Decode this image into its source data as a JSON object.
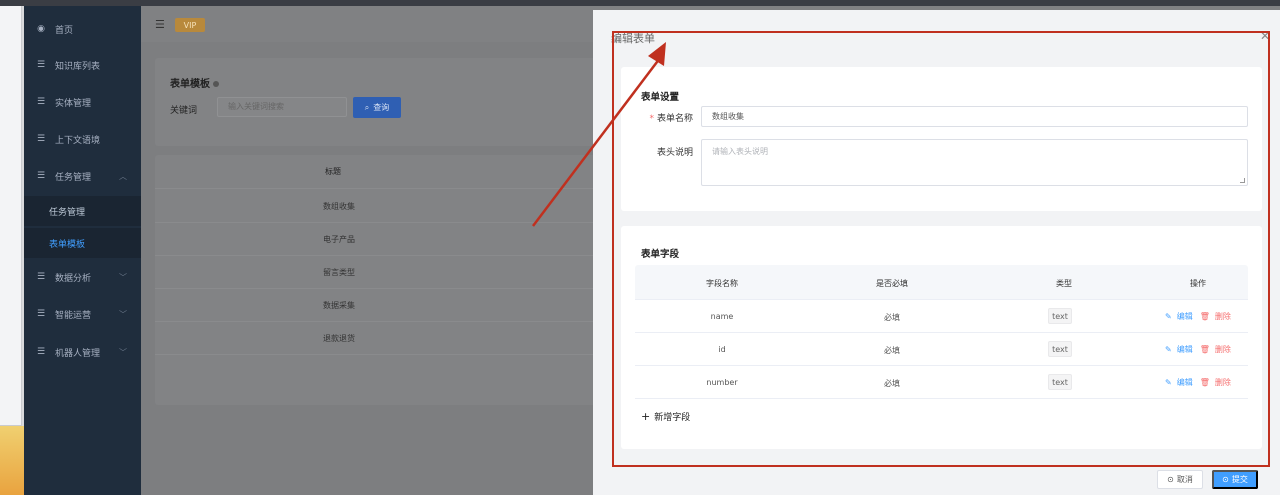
{
  "sidebar": {
    "items": [
      {
        "label": "首页",
        "icon": "dashboard-icon"
      },
      {
        "label": "知识库列表",
        "icon": "list-icon"
      },
      {
        "label": "实体管理",
        "icon": "list-icon"
      },
      {
        "label": "上下文语境",
        "icon": "list-icon"
      },
      {
        "label": "任务管理",
        "icon": "list-icon",
        "expanded": true
      },
      {
        "label": "数据分析",
        "icon": "list-icon"
      },
      {
        "label": "智能运营",
        "icon": "list-icon"
      },
      {
        "label": "机器人管理",
        "icon": "list-icon"
      }
    ],
    "subitems": [
      {
        "label": "任务管理",
        "active": false
      },
      {
        "label": "表单模板",
        "active": true
      }
    ]
  },
  "navbar": {
    "vip_label": "VIP"
  },
  "page": {
    "card_title": "表单模板",
    "keyword_label": "关键词",
    "keyword_placeholder": "输入关键词搜索",
    "search_button": "查询",
    "table_header": "标题",
    "rows": [
      "数组收集",
      "电子产品",
      "留言类型",
      "数据采集",
      "退款退货"
    ]
  },
  "dialog": {
    "title": "编辑表单",
    "settings": {
      "section_title": "表单设置",
      "name_label": "表单名称",
      "name_value": "数组收集",
      "desc_label": "表头说明",
      "desc_placeholder": "请输入表头说明"
    },
    "fields": {
      "section_title": "表单字段",
      "headers": [
        "字段名称",
        "是否必填",
        "类型",
        "操作"
      ],
      "rows": [
        {
          "name": "name",
          "required": "必填",
          "type": "text"
        },
        {
          "name": "id",
          "required": "必填",
          "type": "text"
        },
        {
          "name": "number",
          "required": "必填",
          "type": "text"
        }
      ],
      "edit_label": "编辑",
      "delete_label": "删除",
      "add_label": "新增字段"
    },
    "cancel_label": "取消",
    "submit_label": "提交"
  },
  "colors": {
    "accent": "#409eff",
    "danger": "#f56c6c",
    "annotation": "#c0301f",
    "sidebar_bg": "#1f2d3d"
  }
}
